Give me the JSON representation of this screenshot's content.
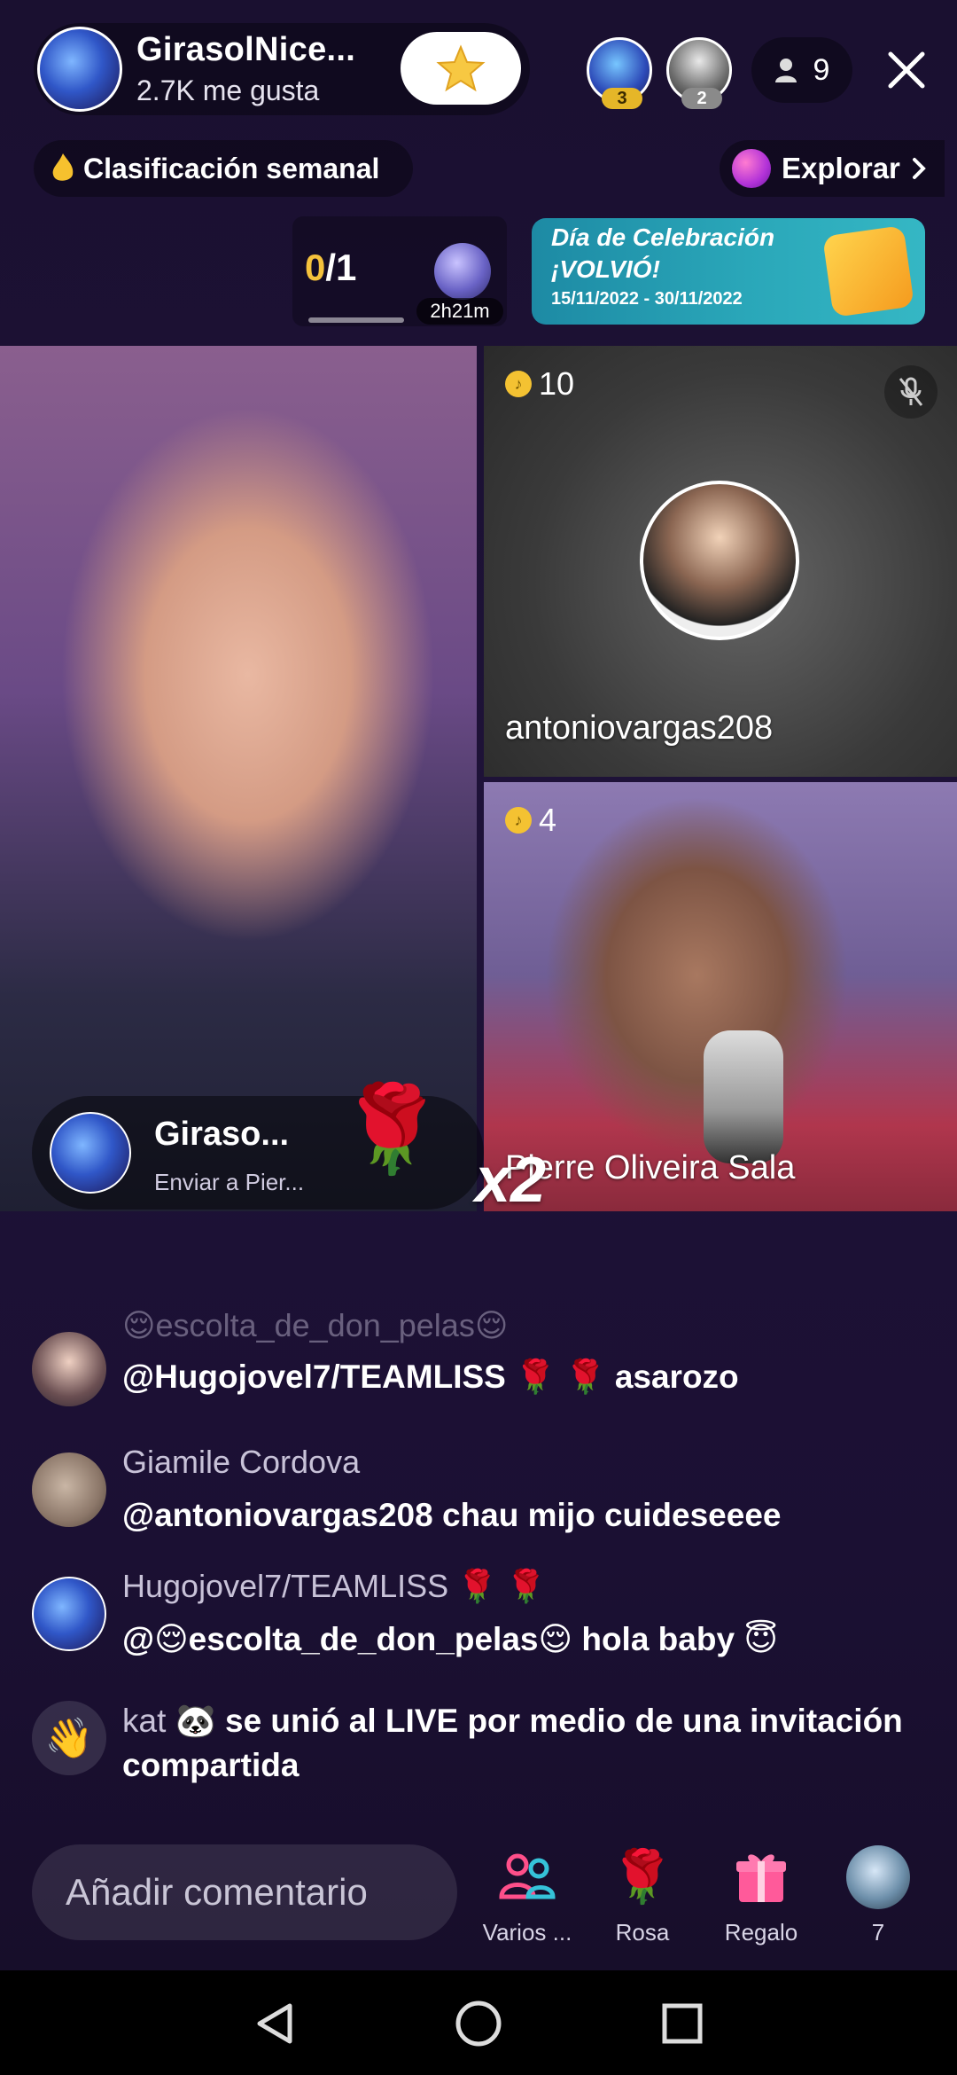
{
  "header": {
    "host_name": "GirasolNice...",
    "likes": "2.7K me gusta",
    "viewer_badges": [
      "3",
      "2"
    ],
    "viewer_count": "9"
  },
  "ranking": {
    "label": "Clasificación semanal",
    "explore_label": "Explorar"
  },
  "goal": {
    "current": "0",
    "total": "/1",
    "timer": "2h21m"
  },
  "banner": {
    "title": "Día de Celebración",
    "subtitle": "¡VOLVIÓ!",
    "dates": "15/11/2022 - 30/11/2022"
  },
  "guests": [
    {
      "name": "antoniovargas208",
      "coins": "10"
    },
    {
      "name": "Pierre Oliveira Sala",
      "coins": "4"
    }
  ],
  "gift_toast": {
    "sender": "Giraso...",
    "message": "Enviar a Pier...",
    "multiplier": "x2"
  },
  "chat": [
    {
      "user": "😌escolta_de_don_pelas😌",
      "text": "@Hugojovel7/TEAMLISS 🌹 🌹  asarozo"
    },
    {
      "user": "Giamile Cordova",
      "text": "@antoniovargas208 chau mijo cuideseeee"
    },
    {
      "user": "Hugojovel7/TEAMLISS 🌹 🌹",
      "text": "@😌escolta_de_don_pelas😌 hola baby 😇"
    },
    {
      "user": "kat 🐼",
      "text": "se unió al LIVE por medio de una invitación compartida"
    }
  ],
  "bottom": {
    "comment_placeholder": "Añadir comentario",
    "actions": [
      "Varios ...",
      "Rosa",
      "Regalo",
      "7"
    ]
  },
  "colors": {
    "accent_pink": "#ff3b7f",
    "gold": "#f5c23c",
    "banner_teal": "#2aa7b9"
  }
}
